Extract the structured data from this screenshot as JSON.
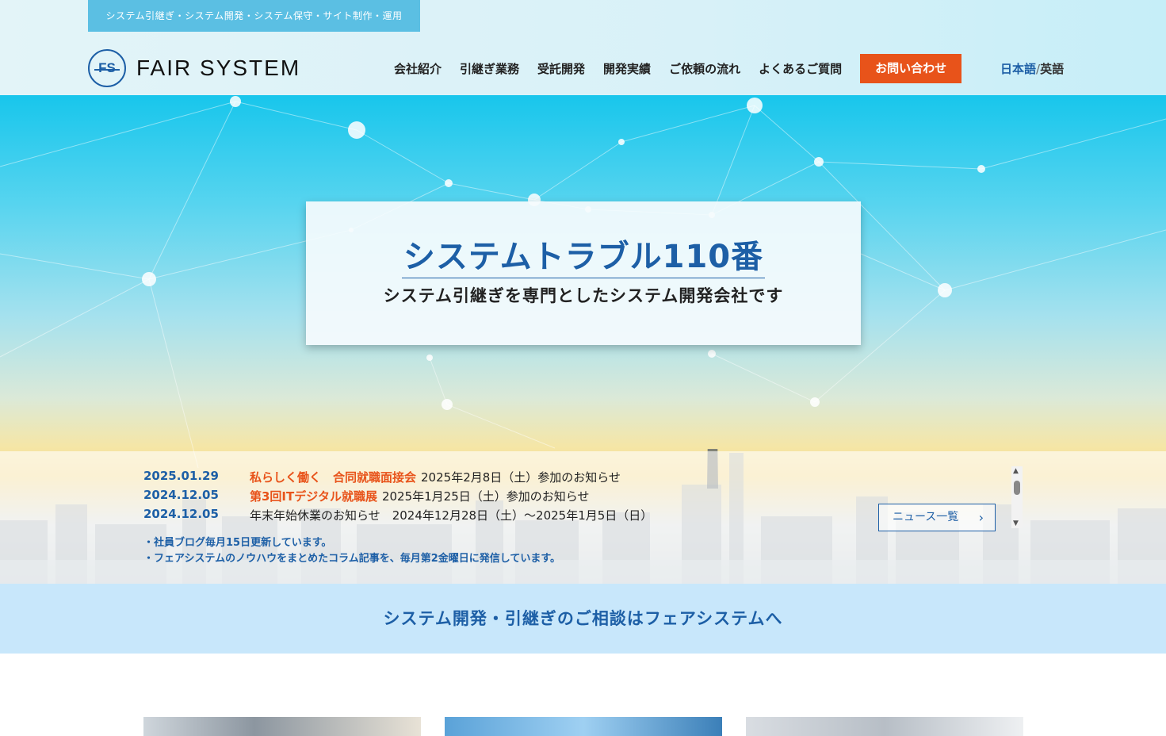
{
  "header": {
    "tagline": "システム引継ぎ・システム開発・システム保守・サイト制作・運用",
    "logo_mark": "FS",
    "logo_text": "FAIR SYSTEM",
    "nav": [
      "会社紹介",
      "引継ぎ業務",
      "受託開発",
      "開発実績",
      "ご依頼の流れ",
      "よくあるご質問"
    ],
    "contact_label": "お問い合わせ",
    "lang_ja": "日本語",
    "lang_sep": "/",
    "lang_en": "英語"
  },
  "hero": {
    "title": "システムトラブル110番",
    "subtitle": "システム引継ぎを専門としたシステム開発会社です"
  },
  "news": {
    "items": [
      {
        "date": "2025.01.29",
        "highlight": "私らしく働く　合同就職面接会",
        "text": "2025年2月8日（土）参加のお知らせ"
      },
      {
        "date": "2024.12.05",
        "highlight": "第3回ITデジタル就職展",
        "text": "2025年1月25日（土）参加のお知らせ"
      },
      {
        "date": "2024.12.05",
        "highlight": "",
        "text": "年末年始休業のお知らせ　2024年12月28日（土）～2025年1月5日（日）"
      }
    ],
    "more_label": "ニュース一覧",
    "notes": [
      "・社員ブログ毎月15日更新しています。",
      "・フェアシステムのノウハウをまとめたコラム記事を、毎月第2金曜日に発信しています。"
    ]
  },
  "band": {
    "text": "システム開発・引継ぎのご相談はフェアシステムへ"
  },
  "colors": {
    "brand_blue": "#1d5fa6",
    "accent_orange": "#e8531a",
    "tagline_bg": "#5bbfe3",
    "band_bg": "#c8e7fb"
  }
}
